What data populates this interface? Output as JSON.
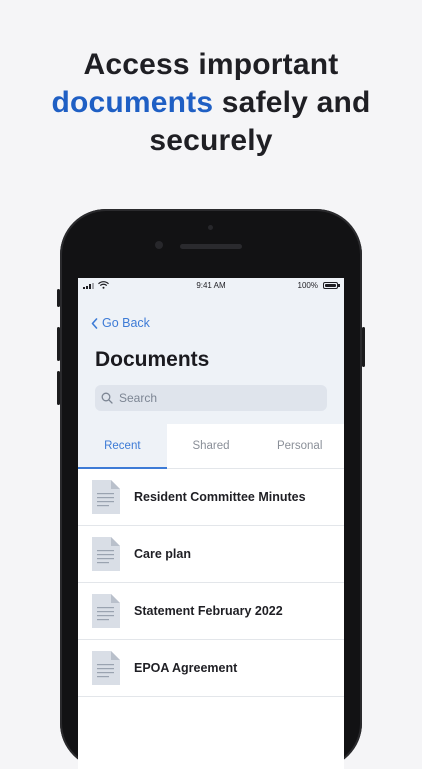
{
  "headline": {
    "line1": "Access important",
    "accent": "documents",
    "line2_rest": " safely and",
    "line3": "securely"
  },
  "status_bar": {
    "time": "9:41 AM",
    "battery": "100%"
  },
  "nav": {
    "back_label": "Go Back"
  },
  "page": {
    "title": "Documents"
  },
  "search": {
    "placeholder": "Search"
  },
  "tabs": [
    {
      "label": "Recent",
      "active": true
    },
    {
      "label": "Shared",
      "active": false
    },
    {
      "label": "Personal",
      "active": false
    }
  ],
  "documents": [
    {
      "name": "Resident Committee Minutes"
    },
    {
      "name": "Care plan"
    },
    {
      "name": "Statement February 2022"
    },
    {
      "name": "EPOA Agreement"
    }
  ],
  "colors": {
    "accent": "#1f5fc4",
    "link": "#3d7bd6",
    "header_bg": "#eef2f7"
  }
}
